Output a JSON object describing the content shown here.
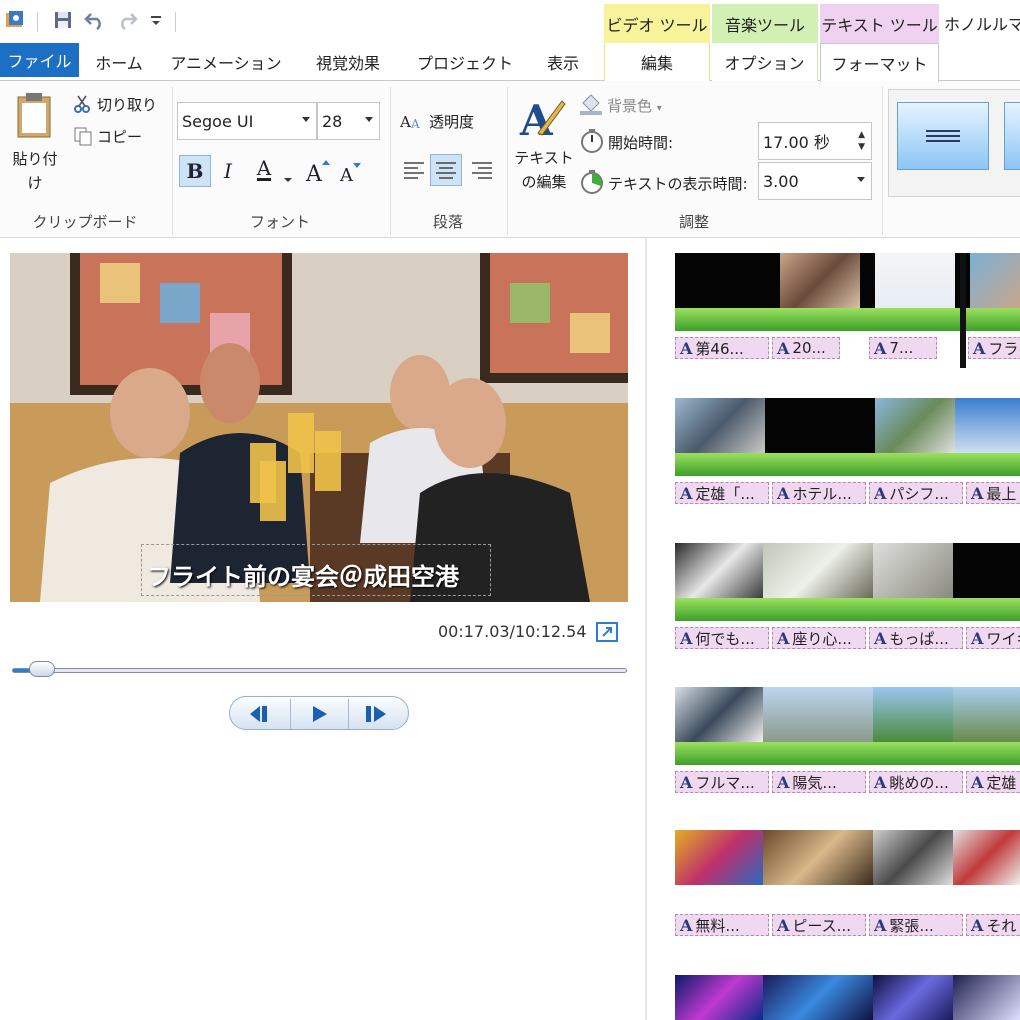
{
  "title_bar": {
    "title": "ホノルルマ"
  },
  "context_groups": {
    "video_tools": "ビデオ ツール",
    "music_tools": "音楽ツール",
    "text_tools": "テキスト ツール"
  },
  "tabs": {
    "file": "ファイル",
    "home": "ホーム",
    "animation": "アニメーション",
    "visual_effects": "視覚効果",
    "project": "プロジェクト",
    "view": "表示",
    "edit": "編集",
    "options": "オプション",
    "format": "フォーマット"
  },
  "ribbon": {
    "clipboard": {
      "paste": "貼り付け",
      "cut": "切り取り",
      "copy": "コピー",
      "label": "クリップボード"
    },
    "font": {
      "family": "Segoe UI",
      "size": "28",
      "bold": "B",
      "italic": "I",
      "color": "A",
      "label": "フォント"
    },
    "paragraph": {
      "transparency": "透明度",
      "label": "段落"
    },
    "adjust": {
      "edit_text": "テキストの編集",
      "background_color": "背景色",
      "start_time_label": "開始時間:",
      "start_time_value": "17.00 秒",
      "duration_label": "テキストの表示時間:",
      "duration_value": "3.00",
      "label": "調整"
    }
  },
  "preview": {
    "caption": "フライト前の宴会＠成田空港",
    "time": "00:17.03/10:12.54",
    "seek_fraction": 0.028
  },
  "storyboard": {
    "rows": [
      {
        "captions": [
          "第46...",
          "20...",
          "7...",
          "フライ"
        ]
      },
      {
        "captions": [
          "定雄「...",
          "ホテル...",
          "パシフ...",
          "最上"
        ]
      },
      {
        "captions": [
          "何でも...",
          "座り心...",
          "もっぱ...",
          "ワイキ"
        ]
      },
      {
        "captions": [
          "フルマ...",
          "陽気...",
          "眺めの...",
          "定雄"
        ]
      },
      {
        "captions": [
          "無料...",
          "ピース...",
          "緊張...",
          "それ"
        ]
      }
    ]
  },
  "colors": {
    "file_tab": "#1c6fc5",
    "video_tools": "#f7f39a",
    "music_tools": "#d3f0b4",
    "text_tools": "#eed2f0",
    "caption_bg": "#f1d8f1"
  }
}
